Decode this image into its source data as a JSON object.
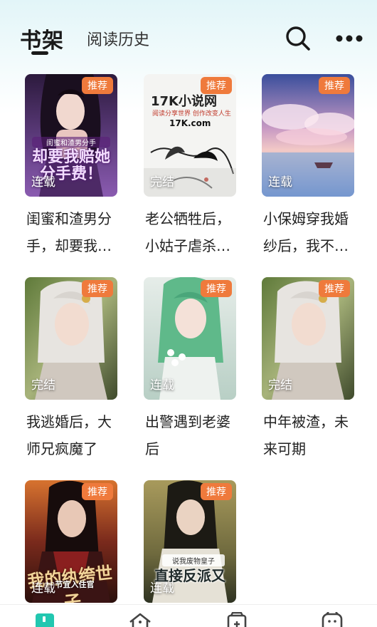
{
  "header": {
    "tab_shelf": "书架",
    "tab_history": "阅读历史"
  },
  "colors": {
    "accent": "#ef7a3c",
    "nav_active": "#22c7b0",
    "nav_inactive": "#444444"
  },
  "books": [
    {
      "tag": "推荐",
      "status": "连载",
      "title": "闺蜜和渣男分手，却要我…",
      "cover_subtitle": "闺蜜和渣男分手",
      "cover_title": "却要我赔她分手费！"
    },
    {
      "tag": "推荐",
      "status": "完结",
      "title": "老公牺牲后，小姑子虐杀…",
      "cover_logo": "17K小说网",
      "cover_logo_sub": "阅读分享世界 创作改变人生",
      "cover_logo_mark": "17K.com"
    },
    {
      "tag": "推荐",
      "status": "连载",
      "title": "小保姆穿我婚纱后，我不…"
    },
    {
      "tag": "推荐",
      "status": "完结",
      "title": "我逃婚后，大师兄疯魔了"
    },
    {
      "tag": "推荐",
      "status": "连载",
      "title": "出警遇到老婆后"
    },
    {
      "tag": "推荐",
      "status": "完结",
      "title": "中年被渣，未来可期"
    },
    {
      "tag": "推荐",
      "status": "连载",
      "title": "",
      "cover_title": "我的纨绔世子",
      "cover_subtitle": "节宜入住官"
    },
    {
      "tag": "推荐",
      "status": "连载",
      "title": "",
      "cover_subtitle": "说我废物皇子",
      "cover_title": "直接反派又"
    }
  ],
  "nav": [
    {
      "icon": "bookshelf-icon",
      "active": true
    },
    {
      "icon": "home-icon",
      "active": false
    },
    {
      "icon": "store-icon",
      "active": false
    },
    {
      "icon": "profile-icon",
      "active": false
    }
  ]
}
